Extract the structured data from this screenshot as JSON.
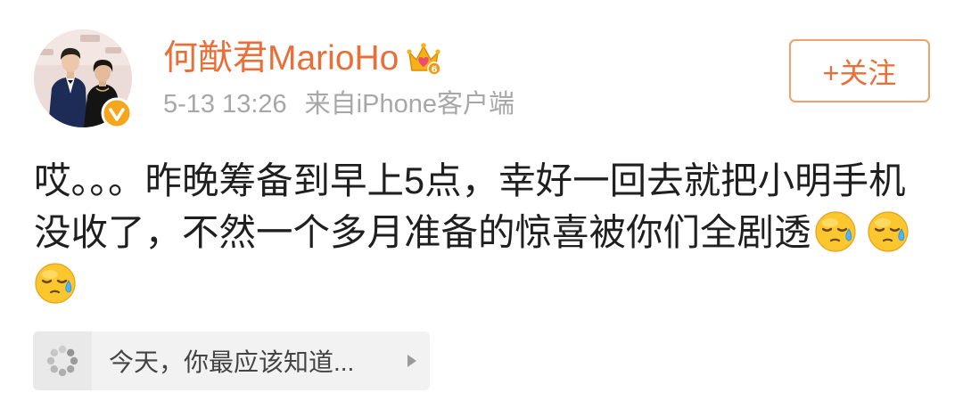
{
  "user": {
    "name": "何猷君MarioHo",
    "vip_level": "6",
    "avatar_icon": "avatar",
    "verified_icon": "verified-v-icon",
    "vip_icon": "vip-crown-icon"
  },
  "meta": {
    "time": "5-13 13:26",
    "source": "来自iPhone客户端"
  },
  "follow_button": {
    "label": "+关注"
  },
  "post": {
    "text": "哎。。。昨晚筹备到早上5点，幸好一回去就把小明手机没收了，不然一个多月准备的惊喜被你们全剧透",
    "emojis": [
      "sweat-emoji-icon",
      "sweat-emoji-icon",
      "sweat-emoji-icon"
    ]
  },
  "topic_card": {
    "label": "今天，你最应该知道...",
    "icon": "spinner-dots-icon",
    "arrow_icon": "play-arrow-icon"
  },
  "colors": {
    "accent": "#e96e37",
    "text": "#1f1f1f",
    "muted": "#a7a7a7",
    "card": "#f2f2f2",
    "border": "#efa06c"
  }
}
